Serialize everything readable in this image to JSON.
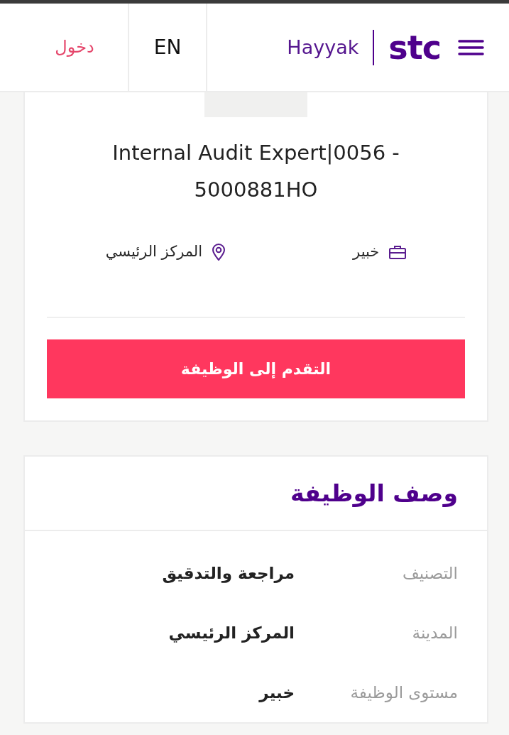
{
  "header": {
    "brand": "stc",
    "product": "Hayyak",
    "language": "EN",
    "login": "دخول"
  },
  "job": {
    "title": "Internal Audit Expert|0056 - 5000881HO",
    "grade": "خبير",
    "location": "المركز الرئيسي",
    "apply_button": "التقدم إلى الوظيفة"
  },
  "description": {
    "heading": "وصف الوظيفة",
    "fields": [
      {
        "label": "التصنيف",
        "value": "مراجعة والتدقيق"
      },
      {
        "label": "المدينة",
        "value": "المركز الرئيسي"
      },
      {
        "label": "مستوى الوظيفة",
        "value": "خبير"
      }
    ]
  }
}
